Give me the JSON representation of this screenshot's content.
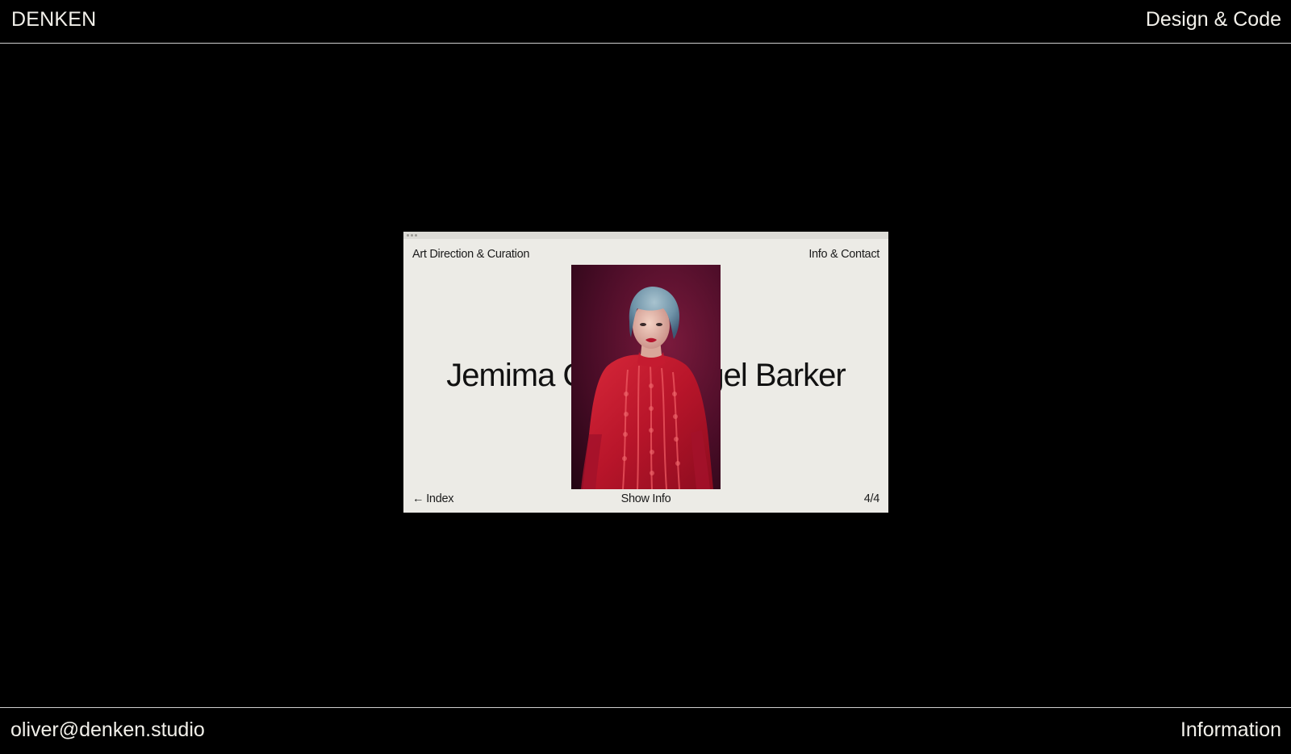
{
  "header": {
    "brand": "DENKEN",
    "tagline": "Design & Code"
  },
  "footer": {
    "email": "oliver@denken.studio",
    "information": "Information"
  },
  "preview": {
    "nav_left": "Art Direction & Curation",
    "nav_right": "Info & Contact",
    "title": "Jemima Cole for Nigel Barker",
    "back_icon": "arrow-left-icon",
    "back_glyph": "←",
    "back_label": "Index",
    "show_info": "Show Info",
    "counter": "4/4"
  },
  "colors": {
    "background": "#000000",
    "foreground": "#f2f0ea",
    "preview_bg": "#ecebe6",
    "preview_text": "#111111",
    "photo_bg": "#5a0f2a",
    "dress_red": "#c4192c",
    "hair_blue": "#6f93a8"
  }
}
